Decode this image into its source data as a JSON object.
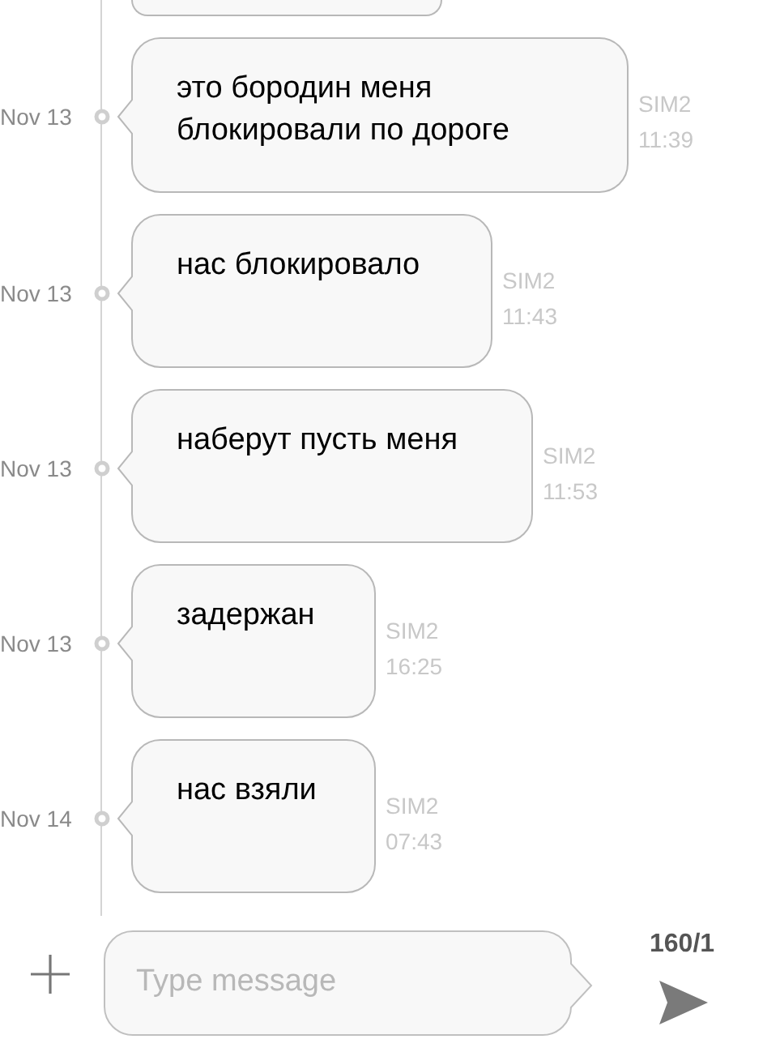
{
  "messages": [
    {
      "date": "Nov 13",
      "text": "это бородин меня блокировали по дороге",
      "sim": "SIM2",
      "time": "11:39"
    },
    {
      "date": "Nov 13",
      "text": "нас блокировало",
      "sim": "SIM2",
      "time": "11:43"
    },
    {
      "date": "Nov 13",
      "text": "наберут пусть меня",
      "sim": "SIM2",
      "time": "11:53"
    },
    {
      "date": "Nov 13",
      "text": "задержан",
      "sim": "SIM2",
      "time": "16:25"
    },
    {
      "date": "Nov 14",
      "text": "нас взяли",
      "sim": "SIM2",
      "time": "07:43"
    }
  ],
  "composer": {
    "placeholder": "Type message",
    "counter": "160/1"
  }
}
